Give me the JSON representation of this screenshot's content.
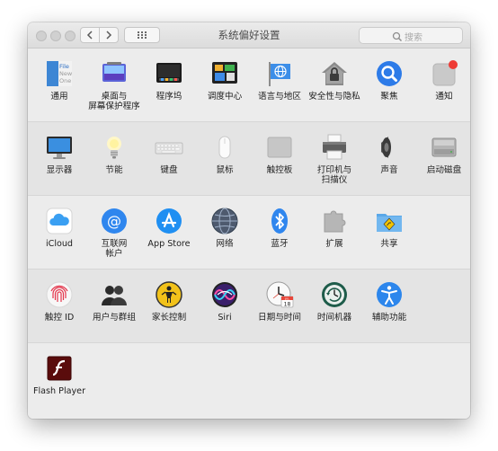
{
  "window": {
    "title": "系统偏好设置"
  },
  "search": {
    "placeholder": "搜索"
  },
  "sections": {
    "row1": {
      "general": "通用",
      "desktop": "桌面与\n屏幕保护程序",
      "dock": "程序坞",
      "mission": "调度中心",
      "language": "语言与地区",
      "security": "安全性与隐私",
      "spotlight": "聚焦",
      "notifications": "通知"
    },
    "row2": {
      "displays": "显示器",
      "energy": "节能",
      "keyboard": "键盘",
      "mouse": "鼠标",
      "trackpad": "触控板",
      "printers": "打印机与\n扫描仪",
      "sound": "声音",
      "startup": "启动磁盘"
    },
    "row3": {
      "icloud": "iCloud",
      "internet": "互联网\n帐户",
      "appstore": "App Store",
      "network": "网络",
      "bluetooth": "蓝牙",
      "extensions": "扩展",
      "sharing": "共享"
    },
    "row4": {
      "touchid": "触控 ID",
      "users": "用户与群组",
      "parental": "家长控制",
      "siri": "Siri",
      "datetime": "日期与时间",
      "timemachine": "时间机器",
      "accessibility": "辅助功能"
    },
    "row5": {
      "flash": "Flash Player"
    }
  },
  "datetime_icon": {
    "month": "JUL",
    "day": "18"
  },
  "general_icon": {
    "line1": "File",
    "line2": "New",
    "line3": "One"
  }
}
